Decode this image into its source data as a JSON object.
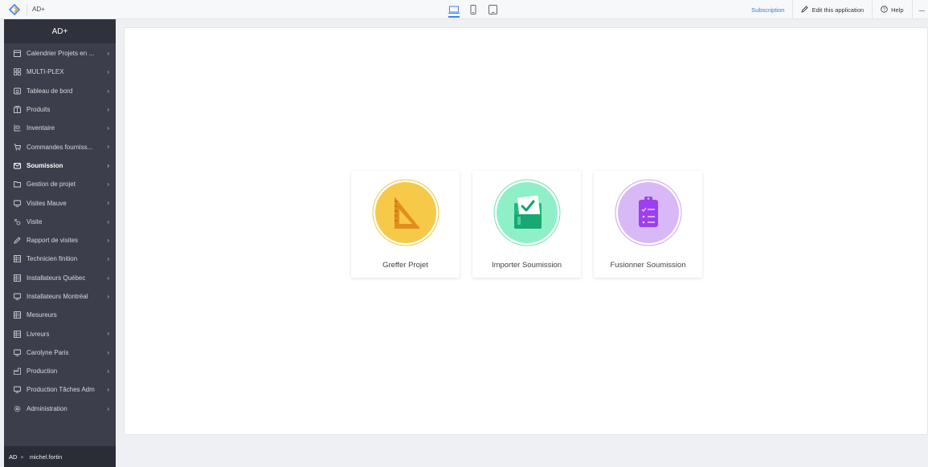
{
  "topbar": {
    "app_name": "AD+",
    "subscription": "Subscription",
    "edit_app": "Edit this application",
    "help": "Help",
    "dash": "—"
  },
  "sidebar": {
    "title": "AD+",
    "items": [
      {
        "label": "Calendrier Projets en ...",
        "icon": "calendar-icon",
        "chevron": true
      },
      {
        "label": "MULTI-PLEX",
        "icon": "grid-icon",
        "chevron": true
      },
      {
        "label": "Tableau de bord",
        "icon": "dashboard-icon",
        "chevron": true
      },
      {
        "label": "Produits",
        "icon": "box-icon",
        "chevron": true
      },
      {
        "label": "Inventaire",
        "icon": "inventory-icon",
        "chevron": true
      },
      {
        "label": "Commandes fourniss...",
        "icon": "cart-icon",
        "chevron": true
      },
      {
        "label": "Soumission",
        "icon": "envelope-icon",
        "chevron": true,
        "active": true
      },
      {
        "label": "Gestion de projet",
        "icon": "folder-icon",
        "chevron": true
      },
      {
        "label": "Visites Mauve",
        "icon": "monitor-icon",
        "chevron": true
      },
      {
        "label": "Visite",
        "icon": "link-icon",
        "chevron": true
      },
      {
        "label": "Rapport de visites",
        "icon": "pen-icon",
        "chevron": true
      },
      {
        "label": "Technicien finition",
        "icon": "table-icon",
        "chevron": true
      },
      {
        "label": "Installateurs Québec",
        "icon": "table-icon",
        "chevron": true
      },
      {
        "label": "Installateurs Montréal",
        "icon": "monitor-icon",
        "chevron": true
      },
      {
        "label": "Mesureurs",
        "icon": "table-icon",
        "chevron": false
      },
      {
        "label": "Livreurs",
        "icon": "table-icon",
        "chevron": true
      },
      {
        "label": "Carolyne Paris",
        "icon": "monitor-icon",
        "chevron": true
      },
      {
        "label": "Production",
        "icon": "factory-icon",
        "chevron": true
      },
      {
        "label": "Production Tâches Adm",
        "icon": "monitor-icon",
        "chevron": true
      },
      {
        "label": "Administration",
        "icon": "gear-icon",
        "chevron": true
      }
    ],
    "chevron": "›",
    "footer_brand": "AD",
    "footer_plus": "+",
    "footer_user": "michel.fortin"
  },
  "cards": [
    {
      "label": "Greffer Projet",
      "icon": "set-square-icon",
      "color": "#f6c93c"
    },
    {
      "label": "Importer Soumission",
      "icon": "import-document-icon",
      "color": "#6fe3b8"
    },
    {
      "label": "Fusionner Soumission",
      "icon": "clipboard-checklist-icon",
      "color": "#c9a5f2"
    }
  ]
}
